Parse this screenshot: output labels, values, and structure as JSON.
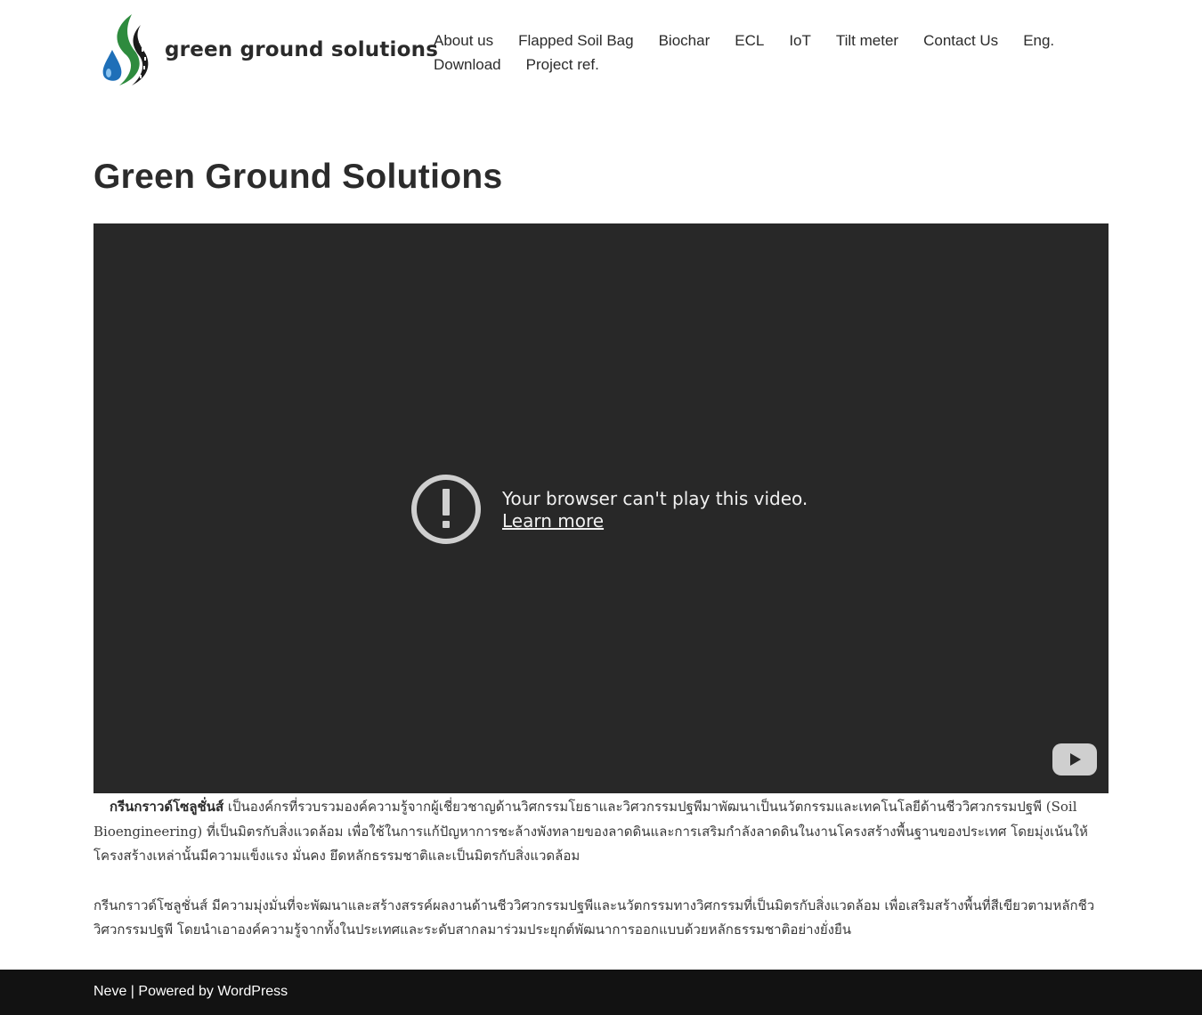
{
  "site": {
    "name": "green ground solutions",
    "logo_icon": "water-drop-road-logo",
    "colors": {
      "logo_green": "#2e8b3e",
      "logo_blue": "#1e6fb8",
      "video_bg": "#282828",
      "footer_bg": "#121212"
    }
  },
  "nav": {
    "items": [
      {
        "label": "About us"
      },
      {
        "label": "Flapped Soil Bag"
      },
      {
        "label": "Biochar"
      },
      {
        "label": "ECL"
      },
      {
        "label": "IoT"
      },
      {
        "label": "Tilt meter"
      },
      {
        "label": "Contact Us"
      },
      {
        "label": "Eng."
      },
      {
        "label": "Download"
      },
      {
        "label": "Project ref."
      }
    ]
  },
  "page": {
    "title": "Green Ground Solutions"
  },
  "video": {
    "error_message": "Your browser can't play this video.",
    "learn_more": "Learn more",
    "error_icon": "exclamation-circle-icon",
    "play_icon": "youtube-play-icon"
  },
  "content": {
    "para1_org": "กรีนกราวด์โซลูชั่นส์",
    "para1_text": " เป็นองค์กรที่รวบรวมองค์ความรู้จากผู้เชี่ยวชาญด้านวิศกรรมโยธาและวิศวกรรมปฐพีมาพัฒนาเป็นนวัตกรรมและเทคโนโลยีด้านชีววิศวกรรมปฐพี (Soil Bioengineering) ที่เป็นมิตรกับสิ่งแวดล้อม เพื่อใช้ในการแก้ปัญหาการชะล้างพังทลายของลาดดินและการเสริมกำลังลาดดินในงานโครงสร้างพื้นฐานของประเทศ โดยมุ่งเน้นให้โครงสร้างเหล่านั้นมีความแข็งแรง มั่นคง ยึดหลักธรรมชาติและเป็นมิตรกับสิ่งแวดล้อม",
    "para2_text": "กรีนกราวด์โซลูชั่นส์ มีความมุ่งมั่นที่จะพัฒนาและสร้างสรรค์ผลงานด้านชีววิศวกรรมปฐพีและนวัตกรรมทางวิศกรรมที่เป็นมิตรกับสิ่งแวดล้อม เพื่อเสริมสร้างพื้นที่สีเขียวตามหลักชีววิศวกรรมปฐพี โดยนำเอาองค์ความรู้จากทั้งในประเทศและระดับสากลมาร่วมประยุกต์พัฒนาการออกแบบด้วยหลักธรรมชาติอย่างยั่งยืน"
  },
  "footer": {
    "theme": "Neve",
    "separator": " | ",
    "powered": "Powered by WordPress"
  }
}
